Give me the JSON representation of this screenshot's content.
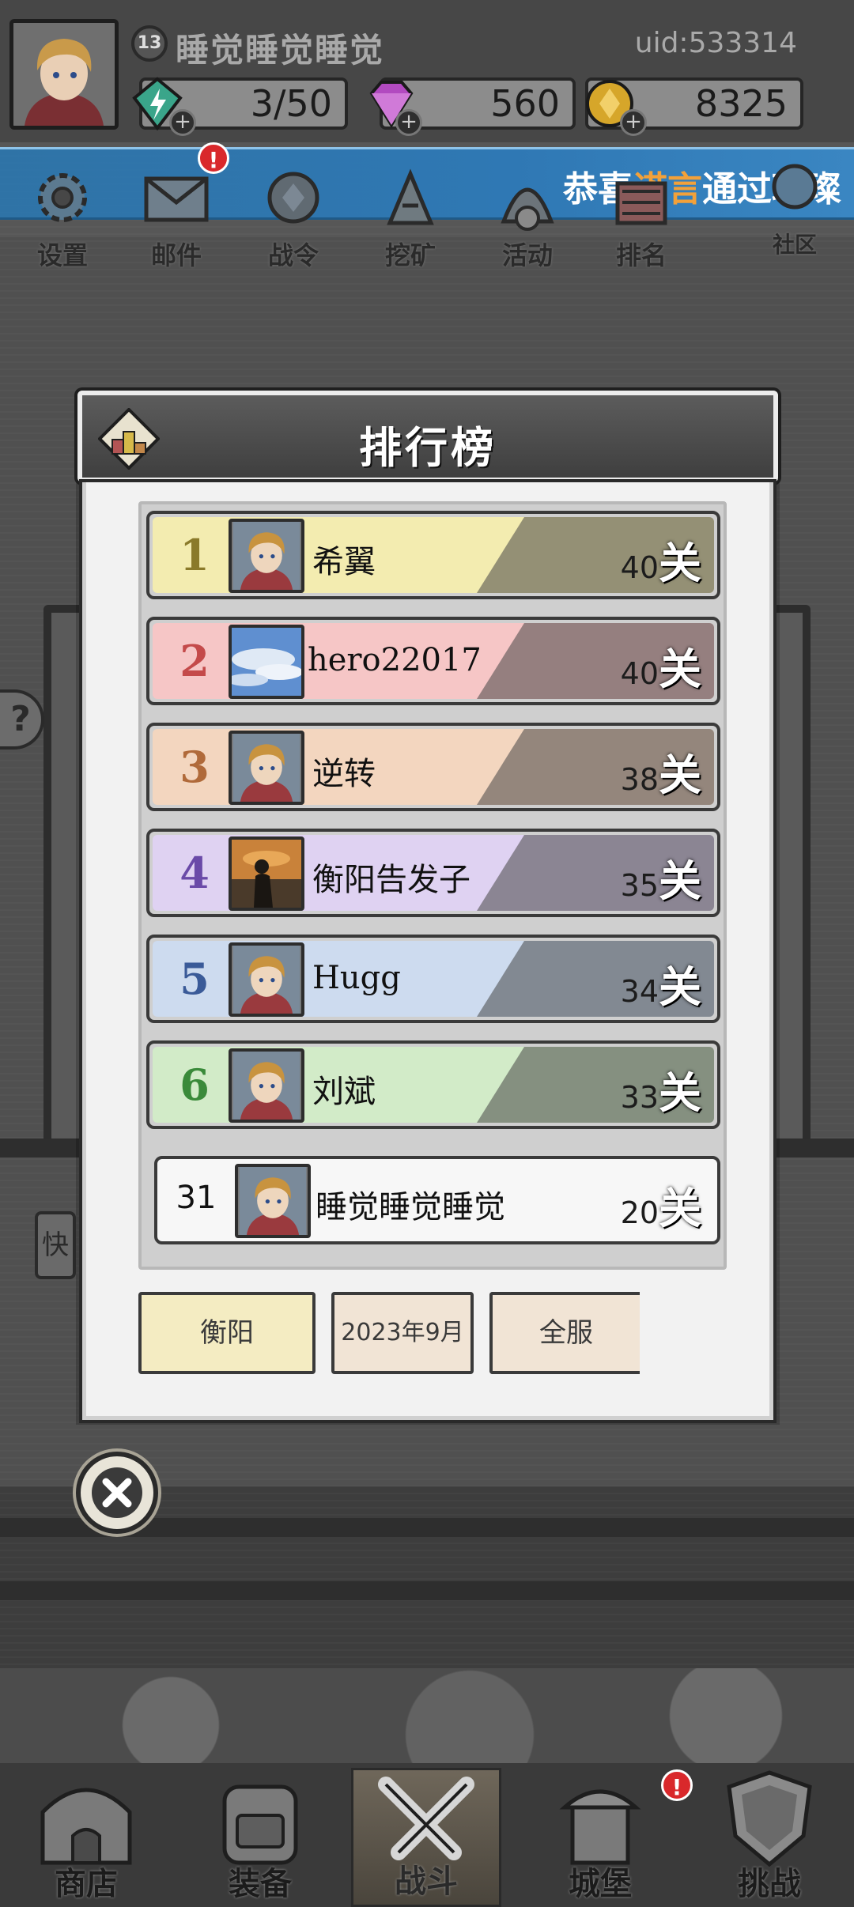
{
  "player": {
    "level": "13",
    "name": "睡觉睡觉睡觉",
    "uid": "uid:533314"
  },
  "resources": {
    "stamina": "3/50",
    "gems": "560",
    "coins": "8325"
  },
  "marquee": {
    "prefix": "恭喜",
    "name": "诺言",
    "suffix": "通过璀璨"
  },
  "menu": [
    {
      "label": "设置",
      "icon": "gear-icon"
    },
    {
      "label": "邮件",
      "icon": "mail-icon",
      "badge": "!"
    },
    {
      "label": "战令",
      "icon": "battle-pass-icon"
    },
    {
      "label": "挖矿",
      "icon": "mining-icon"
    },
    {
      "label": "活动",
      "icon": "event-icon"
    },
    {
      "label": "排名",
      "icon": "ranking-icon"
    },
    {
      "label": "社区",
      "icon": "community-icon"
    }
  ],
  "leaderboard": {
    "title": "排行榜",
    "unit": "关",
    "rows": [
      {
        "rank": "1",
        "name": "希翼",
        "score": "40",
        "color": "#f3ecb0",
        "rank_color": "#8a7a2a",
        "avatar": "hero"
      },
      {
        "rank": "2",
        "name": "hero22017",
        "score": "40",
        "color": "#f6c6c6",
        "rank_color": "#c44a4a",
        "avatar": "sky"
      },
      {
        "rank": "3",
        "name": "逆转",
        "score": "38",
        "color": "#f3d6bf",
        "rank_color": "#b06a3a",
        "avatar": "hero"
      },
      {
        "rank": "4",
        "name": "衡阳告发子",
        "score": "35",
        "color": "#dfd2f2",
        "rank_color": "#6a4aa8",
        "avatar": "sunset"
      },
      {
        "rank": "5",
        "name": "Hugg",
        "score": "34",
        "color": "#cddbef",
        "rank_color": "#3a5a98",
        "avatar": "hero"
      },
      {
        "rank": "6",
        "name": "刘斌",
        "score": "33",
        "color": "#d2ebc8",
        "rank_color": "#3a8a3a",
        "avatar": "hero"
      }
    ],
    "me": {
      "rank": "31",
      "name": "睡觉睡觉睡觉",
      "score": "20"
    },
    "filters": [
      "衡阳",
      "2023年9月",
      "全服"
    ]
  },
  "bottom_nav": [
    {
      "label": "商店",
      "icon": "shop-icon"
    },
    {
      "label": "装备",
      "icon": "backpack-icon"
    },
    {
      "label": "战斗",
      "icon": "crossed-swords-icon"
    },
    {
      "label": "城堡",
      "icon": "castle-icon",
      "badge": "!"
    },
    {
      "label": "挑战",
      "icon": "shield-icon"
    }
  ]
}
